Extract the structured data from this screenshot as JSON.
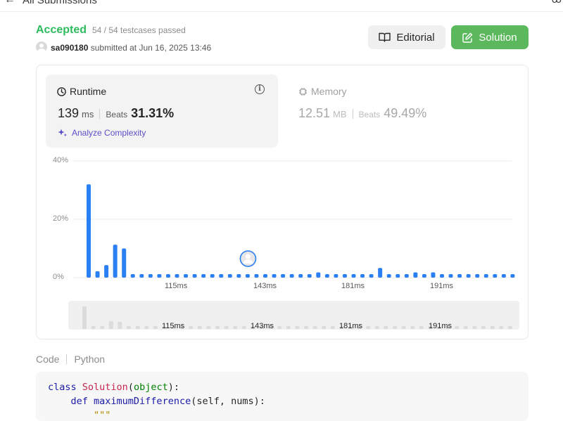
{
  "topbar": {
    "back_arrow": "←",
    "title": "All Submissions",
    "right_glyph": "ꝏ"
  },
  "submission": {
    "status": "Accepted",
    "testcases": "54 / 54 testcases passed",
    "user": "sa090180",
    "submitted_prefix": "submitted at",
    "submitted_at": "Jun 16, 2025 13:46"
  },
  "buttons": {
    "editorial": "Editorial",
    "solution": "Solution"
  },
  "runtime": {
    "title": "Runtime",
    "value": "139",
    "unit": "ms",
    "beats_label": "Beats",
    "beats_value": "31.31%",
    "analyze_label": "Analyze Complexity"
  },
  "memory": {
    "title": "Memory",
    "value": "12.51",
    "unit": "MB",
    "beats_label": "Beats",
    "beats_value": "49.49%"
  },
  "chart_data": {
    "type": "bar",
    "ylim": [
      0,
      40
    ],
    "yticks": [
      "40%",
      "20%",
      "0%"
    ],
    "xticks": [
      "115ms",
      "143ms",
      "181ms",
      "191ms"
    ],
    "values": [
      32,
      2.2,
      4.3,
      11.3,
      10,
      1.2,
      1.2,
      1.2,
      1.2,
      1.2,
      1.2,
      1.2,
      1.2,
      1.2,
      1.2,
      1.2,
      1.2,
      1.2,
      1.2,
      1.2,
      1.2,
      1.2,
      1.2,
      1.2,
      1.2,
      1.2,
      1.8,
      1.2,
      1.2,
      1.2,
      1.2,
      1.2,
      1.2,
      3.3,
      1.2,
      1.2,
      1.2,
      1.8,
      1.2,
      1.8,
      1.2,
      1.2,
      1.2,
      1.2,
      1.2,
      1.2,
      1.2,
      1.2,
      1.2
    ],
    "highlight_index": 19,
    "bar_color": "#2a7ff2",
    "grid": true
  },
  "code": {
    "label": "Code",
    "language": "Python",
    "lines": [
      [
        {
          "t": "class ",
          "c": "kw"
        },
        {
          "t": "Solution",
          "c": "cls"
        },
        {
          "t": "(",
          "c": "nm"
        },
        {
          "t": "object",
          "c": "bi"
        },
        {
          "t": "):",
          "c": "nm"
        }
      ],
      [
        {
          "t": "    def ",
          "c": "kw"
        },
        {
          "t": "maximumDifference",
          "c": "fn"
        },
        {
          "t": "(self, nums):",
          "c": "nm"
        }
      ],
      [
        {
          "t": "        \"\"\"",
          "c": "st"
        }
      ]
    ]
  }
}
